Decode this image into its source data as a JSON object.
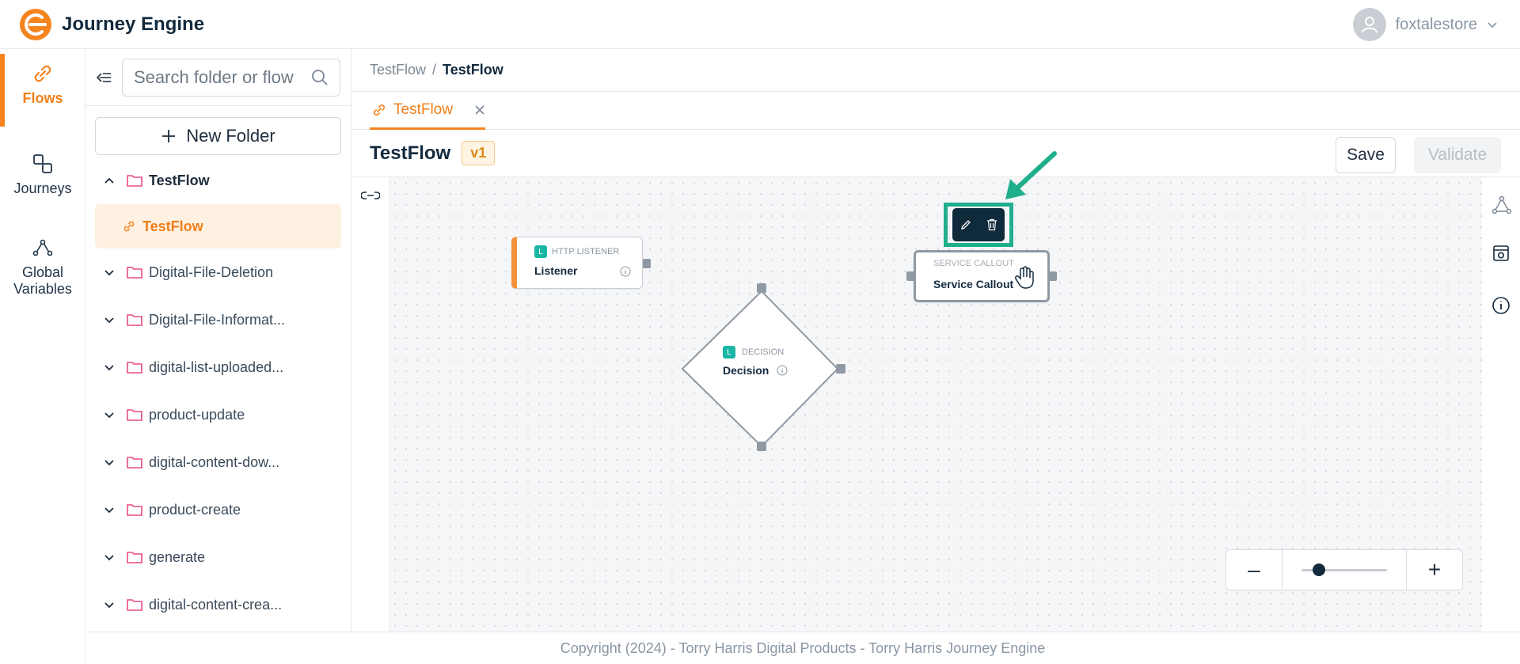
{
  "app": {
    "title": "Journey Engine",
    "brand_color": "#f5841f"
  },
  "user": {
    "name": "foxtalestore"
  },
  "nav_rail": [
    {
      "label": "Flows",
      "icon": "link-icon",
      "active": true
    },
    {
      "label": "Journeys",
      "icon": "journeys-icon",
      "active": false
    },
    {
      "label": "Global",
      "label2": "Variables",
      "icon": "variables-icon",
      "active": false
    }
  ],
  "tree": {
    "search_placeholder": "Search folder or flow",
    "new_folder_label": "New Folder",
    "root": {
      "label": "TestFlow"
    },
    "selected_flow": {
      "label": "TestFlow"
    },
    "folders": [
      {
        "label": "Digital-File-Deletion"
      },
      {
        "label": "Digital-File-Informat..."
      },
      {
        "label": "digital-list-uploaded..."
      },
      {
        "label": "product-update"
      },
      {
        "label": "digital-content-dow..."
      },
      {
        "label": "product-create"
      },
      {
        "label": "generate"
      },
      {
        "label": "digital-content-crea..."
      }
    ]
  },
  "breadcrumb": {
    "parent": "TestFlow",
    "sep": "/",
    "current": "TestFlow"
  },
  "tab": {
    "label": "TestFlow"
  },
  "flow": {
    "title": "TestFlow",
    "version": "v1",
    "save_label": "Save",
    "validate_label": "Validate"
  },
  "canvas": {
    "nodes": {
      "listener": {
        "badge": "L",
        "type": "HTTP LISTENER",
        "name": "Listener"
      },
      "decision": {
        "badge": "L",
        "type": "DECISION",
        "name": "Decision"
      },
      "callout": {
        "type": "SERVICE CALLOUT",
        "name": "Service Callout"
      }
    },
    "zoom": {
      "minus": "–",
      "plus": "+",
      "level": 0.2
    }
  },
  "footer": {
    "text": "Copyright (2024) - Torry Harris Digital Products - Torry Harris Journey Engine"
  }
}
